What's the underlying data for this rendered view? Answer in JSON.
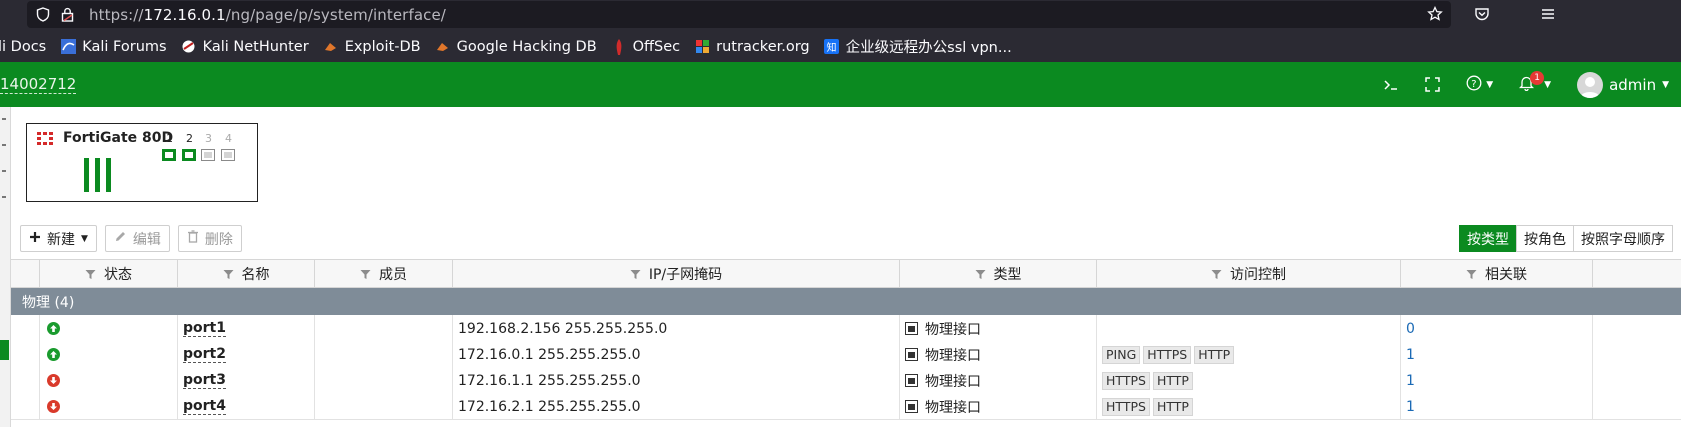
{
  "browser": {
    "url_prefix": "https://",
    "url_host": "172.16.0.1",
    "url_path": "/ng/page/p/system/interface/",
    "bookmarks": [
      {
        "label": "li Docs",
        "icon": "kali-icon"
      },
      {
        "label": "Kali Forums",
        "icon": "kali-icon"
      },
      {
        "label": "Kali NetHunter",
        "icon": "nethunter-icon"
      },
      {
        "label": "Exploit-DB",
        "icon": "exploitdb-icon"
      },
      {
        "label": "Google Hacking DB",
        "icon": "ghdb-icon"
      },
      {
        "label": "OffSec",
        "icon": "offsec-icon"
      },
      {
        "label": "rutracker.org",
        "icon": "rutracker-icon"
      },
      {
        "label": "企业级远程办公ssl vpn...",
        "icon": "zhihu-icon"
      }
    ]
  },
  "header": {
    "serial": "14002712",
    "notification_count": "1",
    "user": "admin"
  },
  "device": {
    "name": "FortiGate 80D",
    "ports": [
      {
        "num": "1",
        "active": true
      },
      {
        "num": "2",
        "active": true
      },
      {
        "num": "3",
        "active": false
      },
      {
        "num": "4",
        "active": false
      }
    ]
  },
  "toolbar": {
    "new_label": "新建",
    "edit_label": "编辑",
    "delete_label": "删除",
    "views": [
      "按类型",
      "按角色",
      "按照字母顺序"
    ],
    "active_view": "按类型"
  },
  "table": {
    "columns": [
      "状态",
      "名称",
      "成员",
      "IP/子网掩码",
      "类型",
      "访问控制",
      "相关联"
    ],
    "group_label": "物理 (4)",
    "rows": [
      {
        "status": "up",
        "name": "port1",
        "member": "",
        "ip": "192.168.2.156 255.255.255.0",
        "type": "物理接口",
        "access": [],
        "refs": "0"
      },
      {
        "status": "up",
        "name": "port2",
        "member": "",
        "ip": "172.16.0.1 255.255.255.0",
        "type": "物理接口",
        "access": [
          "PING",
          "HTTPS",
          "HTTP"
        ],
        "refs": "1"
      },
      {
        "status": "down",
        "name": "port3",
        "member": "",
        "ip": "172.16.1.1 255.255.255.0",
        "type": "物理接口",
        "access": [
          "HTTPS",
          "HTTP"
        ],
        "refs": "1"
      },
      {
        "status": "down",
        "name": "port4",
        "member": "",
        "ip": "172.16.2.1 255.255.255.0",
        "type": "物理接口",
        "access": [
          "HTTPS",
          "HTTP"
        ],
        "refs": "1"
      }
    ]
  },
  "colors": {
    "brand": "#0b8a20",
    "group_bar": "#7f8c98",
    "link": "#1b6ab5",
    "up": "#1a9b2e",
    "down": "#d93a2b"
  }
}
